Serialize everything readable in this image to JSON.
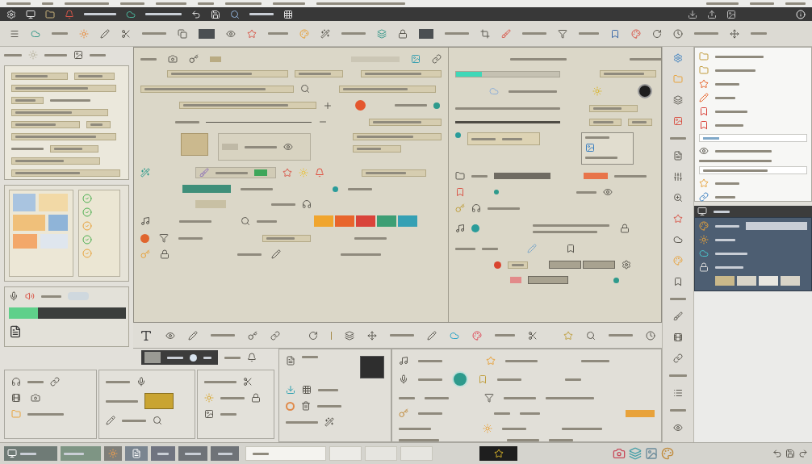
{
  "canvas": {
    "swatches": [
      {
        "color": "#f0a52e"
      },
      {
        "color": "#e8652c"
      },
      {
        "color": "#d9433a"
      },
      {
        "color": "#3d9e74"
      },
      {
        "color": "#35a0b4"
      }
    ],
    "status_dots": [
      {
        "color": "#e4572e"
      },
      {
        "color": "#2e9a8c"
      },
      {
        "color": "#e0652e"
      },
      {
        "color": "#2a9c9a"
      },
      {
        "color": "#d9442f"
      }
    ],
    "progress": {
      "level": 0.25
    }
  },
  "mixer": {
    "meter": {
      "level": 0.25
    }
  }
}
